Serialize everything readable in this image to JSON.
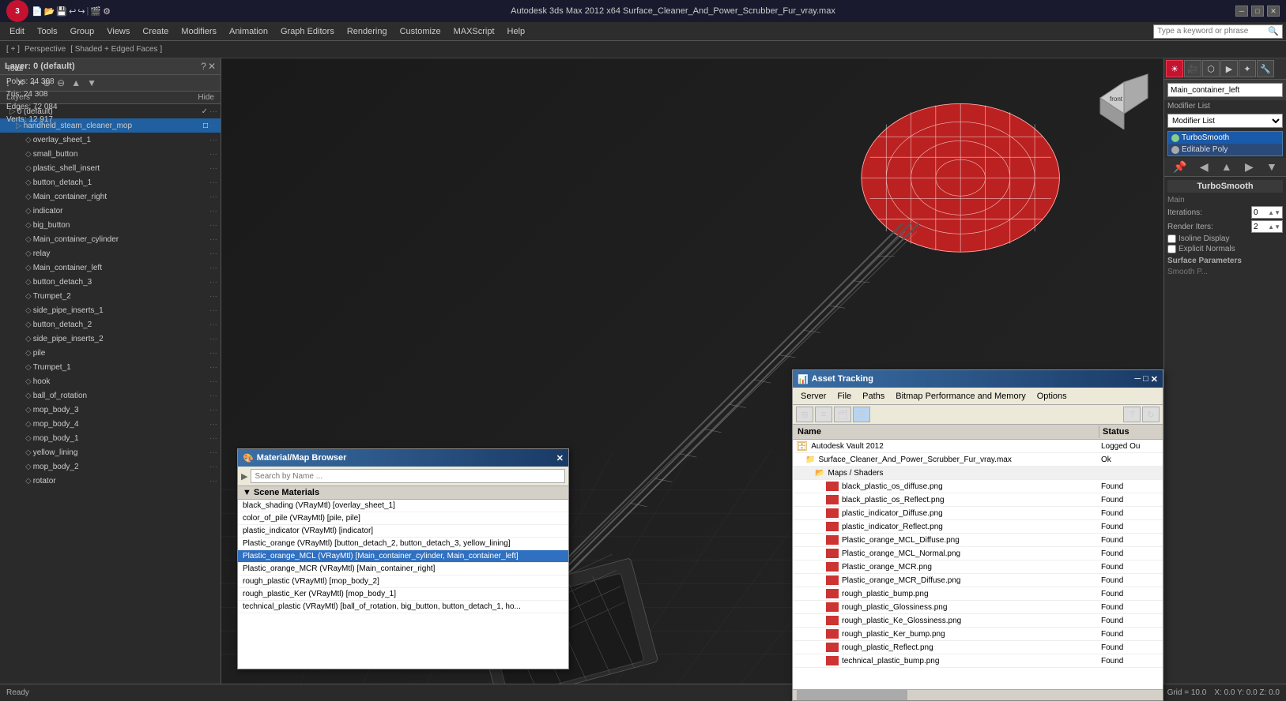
{
  "app": {
    "title": "Autodesk 3ds Max 2012 x64",
    "filename": "Surface_Cleaner_And_Power_Scrubber_Fur_vray.max",
    "full_title": "Autodesk 3ds Max 2012 x64    Surface_Cleaner_And_Power_Scrubber_Fur_vray.max"
  },
  "titlebar": {
    "logo": "3",
    "win_minimize": "─",
    "win_restore": "□",
    "win_close": "✕"
  },
  "menubar": {
    "items": [
      "Edit",
      "Tools",
      "Group",
      "Views",
      "Create",
      "Modifiers",
      "Animation",
      "Graph Editors",
      "Rendering",
      "Customize",
      "MAXScript",
      "Help"
    ],
    "search_placeholder": "Type a keyword or phrase"
  },
  "viewinfo": {
    "bracket": "[ + ]",
    "view": "Perspective",
    "shading": "Shaded + Edged Faces"
  },
  "stats": {
    "polys_label": "Polys:",
    "polys_value": "24 308",
    "tris_label": "Tris:",
    "tris_value": "24 308",
    "edges_label": "Edges:",
    "edges_value": "72 084",
    "verts_label": "Verts:",
    "verts_value": "12 917",
    "total_label": "Total"
  },
  "layers": {
    "panel_title": "Layer: 0 (default)",
    "help": "?",
    "close": "✕",
    "col_layers": "Layers",
    "col_hide": "Hide",
    "items": [
      {
        "name": "0 (default)",
        "depth": 1,
        "check": "✓",
        "is_default": true
      },
      {
        "name": "handheld_steam_cleaner_mop",
        "depth": 2,
        "selected": true
      },
      {
        "name": "overlay_sheet_1",
        "depth": 3
      },
      {
        "name": "small_button",
        "depth": 3
      },
      {
        "name": "plastic_shell_insert",
        "depth": 3
      },
      {
        "name": "button_detach_1",
        "depth": 3
      },
      {
        "name": "Main_container_right",
        "depth": 3
      },
      {
        "name": "indicator",
        "depth": 3
      },
      {
        "name": "big_button",
        "depth": 3
      },
      {
        "name": "Main_container_cylinder",
        "depth": 3
      },
      {
        "name": "relay",
        "depth": 3
      },
      {
        "name": "Main_container_left",
        "depth": 3
      },
      {
        "name": "button_detach_3",
        "depth": 3
      },
      {
        "name": "Trumpet_2",
        "depth": 3
      },
      {
        "name": "side_pipe_inserts_1",
        "depth": 3
      },
      {
        "name": "button_detach_2",
        "depth": 3
      },
      {
        "name": "side_pipe_inserts_2",
        "depth": 3
      },
      {
        "name": "pile",
        "depth": 3
      },
      {
        "name": "Trumpet_1",
        "depth": 3
      },
      {
        "name": "hook",
        "depth": 3
      },
      {
        "name": "ball_of_rotation",
        "depth": 3
      },
      {
        "name": "mop_body_3",
        "depth": 3
      },
      {
        "name": "mop_body_4",
        "depth": 3
      },
      {
        "name": "mop_body_1",
        "depth": 3
      },
      {
        "name": "yellow_lining",
        "depth": 3
      },
      {
        "name": "mop_body_2",
        "depth": 3
      },
      {
        "name": "rotator",
        "depth": 3
      }
    ]
  },
  "right_panel": {
    "obj_name": "Main_container_left",
    "modifier_list_label": "Modifier List",
    "modifier_dropdown": "Modifier List",
    "modifiers": [
      {
        "name": "TurboSmooth",
        "active": true
      },
      {
        "name": "Editable Poly",
        "active": false
      }
    ],
    "smooth_title": "TurboSmooth",
    "main_label": "Main",
    "iterations_label": "Iterations:",
    "iterations_value": "0",
    "render_iters_label": "Render Iters:",
    "render_iters_value": "2",
    "isoline_label": "Isoline Display",
    "explicit_label": "Explicit Normals",
    "surface_params_label": "Surface Parameters",
    "smooth_param": "Smooth P..."
  },
  "asset_tracking": {
    "title": "Asset Tracking",
    "menus": [
      "Server",
      "File",
      "Paths",
      "Bitmap Performance and Memory",
      "Options"
    ],
    "col_name": "Name",
    "col_status": "Status",
    "items": [
      {
        "indent": 0,
        "name": "Autodesk Vault 2012",
        "status": "Logged Ou",
        "type": "vault"
      },
      {
        "indent": 1,
        "name": "Surface_Cleaner_And_Power_Scrubber_Fur_vray.max",
        "status": "Ok",
        "type": "file"
      },
      {
        "indent": 2,
        "name": "Maps / Shaders",
        "status": "",
        "type": "folder"
      },
      {
        "indent": 3,
        "name": "black_plastic_os_diffuse.png",
        "status": "Found",
        "type": "img"
      },
      {
        "indent": 3,
        "name": "black_plastic_os_Reflect.png",
        "status": "Found",
        "type": "img"
      },
      {
        "indent": 3,
        "name": "plastic_indicator_Diffuse.png",
        "status": "Found",
        "type": "img"
      },
      {
        "indent": 3,
        "name": "plastic_indicator_Reflect.png",
        "status": "Found",
        "type": "img"
      },
      {
        "indent": 3,
        "name": "Plastic_orange_MCL_Diffuse.png",
        "status": "Found",
        "type": "img"
      },
      {
        "indent": 3,
        "name": "Plastic_orange_MCL_Normal.png",
        "status": "Found",
        "type": "img"
      },
      {
        "indent": 3,
        "name": "Plastic_orange_MCR.png",
        "status": "Found",
        "type": "img"
      },
      {
        "indent": 3,
        "name": "Plastic_orange_MCR_Diffuse.png",
        "status": "Found",
        "type": "img"
      },
      {
        "indent": 3,
        "name": "rough_plastic_bump.png",
        "status": "Found",
        "type": "img"
      },
      {
        "indent": 3,
        "name": "rough_plastic_Glossiness.png",
        "status": "Found",
        "type": "img"
      },
      {
        "indent": 3,
        "name": "rough_plastic_Ke_Glossiness.png",
        "status": "Found",
        "type": "img"
      },
      {
        "indent": 3,
        "name": "rough_plastic_Ker_bump.png",
        "status": "Found",
        "type": "img"
      },
      {
        "indent": 3,
        "name": "rough_plastic_Reflect.png",
        "status": "Found",
        "type": "img"
      },
      {
        "indent": 3,
        "name": "technical_plastic_bump.png",
        "status": "Found",
        "type": "img"
      }
    ]
  },
  "material_browser": {
    "title": "Material/Map Browser",
    "search_placeholder": "Search by Name ...",
    "section_label": "Scene Materials",
    "materials": [
      "black_shading (VRayMtl) [overlay_sheet_1]",
      "color_of_pile (VRayMtl) [pile, pile]",
      "plastic_indicator (VRayMtl) [indicator]",
      "Plastic_orange (VRayMtl) [button_detach_2, button_detach_3, yellow_lining]",
      "Plastic_orange_MCL (VRayMtl) [Main_container_cylinder, Main_container_left]",
      "Plastic_orange_MCR (VRayMtl) [Main_container_right]",
      "rough_plastic (VRayMtl) [mop_body_2]",
      "rough_plastic_Ker (VRayMtl) [mop_body_1]",
      "technical_plastic (VRayMtl) [ball_of_rotation, big_button, button_detach_1, ho..."
    ],
    "selected_index": 4
  },
  "colors": {
    "accent_blue": "#2060a0",
    "titlebar_gradient_start": "#3a6ea5",
    "titlebar_gradient_end": "#1a3a65",
    "modifier_active": "#1a5aaa",
    "found_color": "#000"
  }
}
